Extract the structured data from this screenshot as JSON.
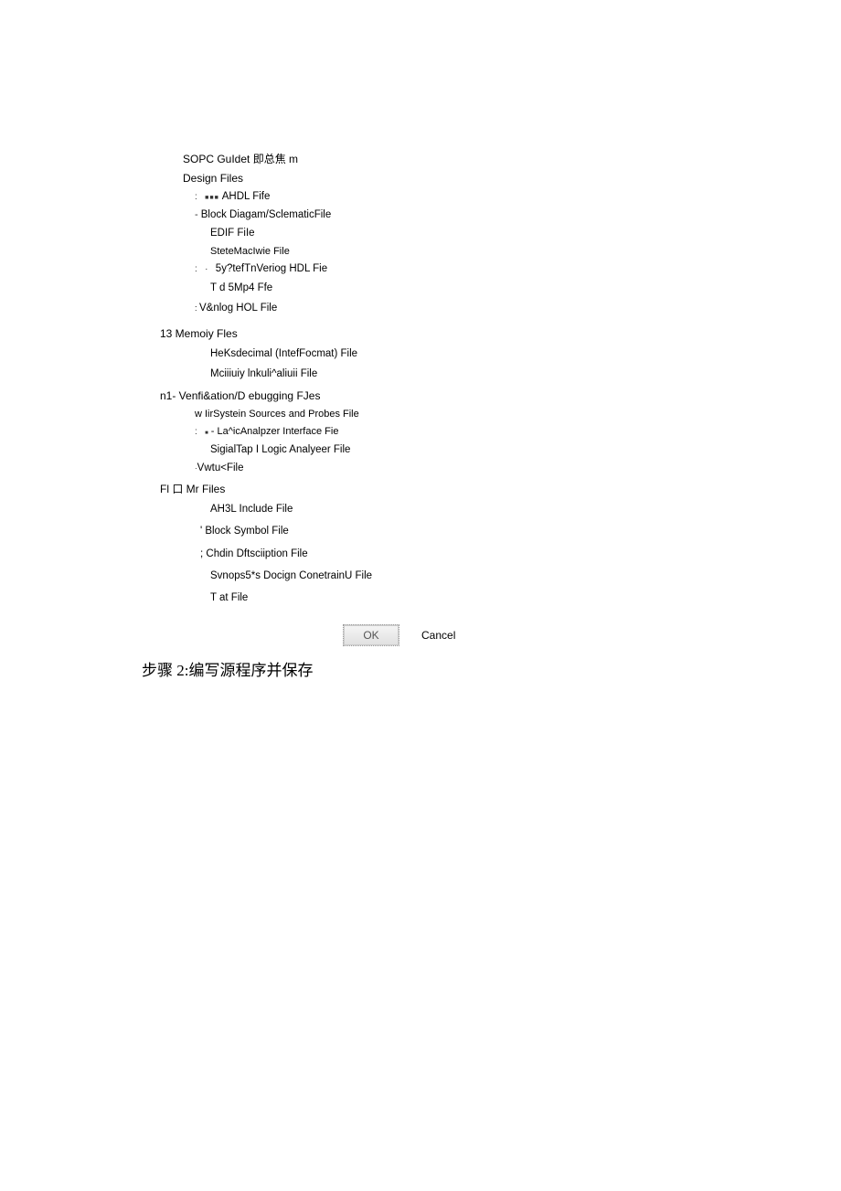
{
  "tree": {
    "sopc": "SOPC GuIdet 即总焦  m",
    "design_files": "Design Files",
    "ahdl": "AHDL Fife",
    "block_diagram": "Block Diagam/SclematicFile",
    "edif": "EDIF FiIe",
    "state_machine": "SteteMacIwie File",
    "system_verilog": "5y?tefTnVeriog HDL Fie",
    "td5mp4": "T d 5Mp4 Ffe",
    "verilog_hdl": "V&nlog HOL File",
    "memory_files": "13 Memoiy Fles",
    "hex": "HeKsdecimal (IntefFocmat) File",
    "mif": "Mciiiuiy lnkuli^aliuii File",
    "verification": "n1- Venfi&ation/D ebugging FJes",
    "insystem": "w IirSystein Sources and Probes File",
    "logic_analyzer": "La^icAnalpzer Interface Fie",
    "signaltap": "SigialTap I Logic Analyeer File",
    "vwtu": "Vwtu<File",
    "other_files": "Fl 口  Mr Files",
    "ahdl_include": "AH3L Include File",
    "block_symbol": "' Block Symbol File",
    "chain_desc": "; Chdin Dftsciiption File",
    "synopsys": "Svnops5*s Docign ConetrainU File",
    "tat": "T at File"
  },
  "buttons": {
    "ok": "OK",
    "cancel": "Cancel"
  },
  "step_text": "步骤 2:编写源程序并保存"
}
